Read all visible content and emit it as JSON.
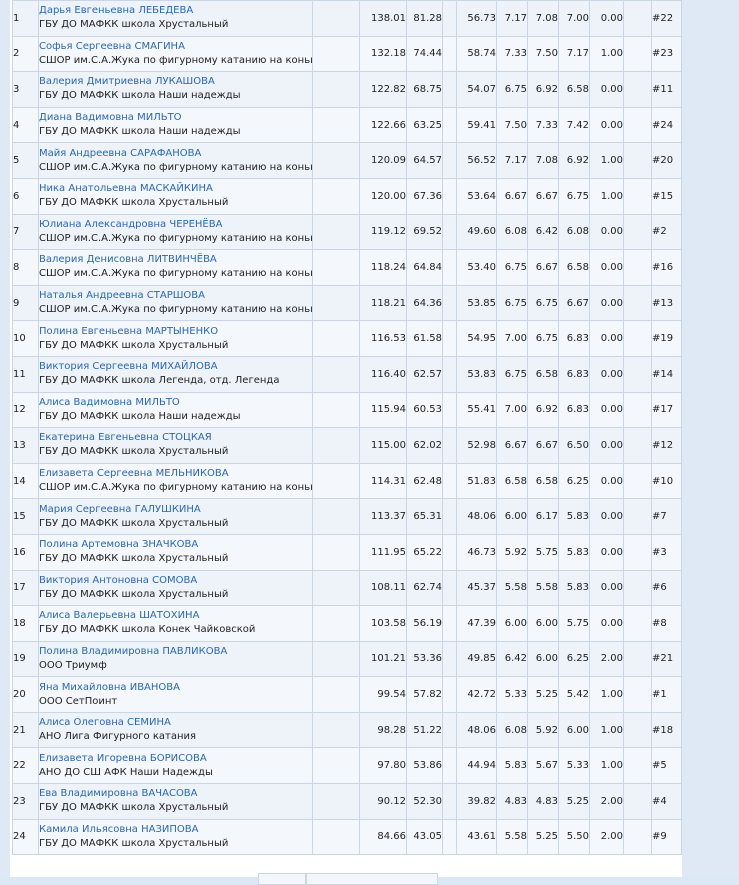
{
  "rows": [
    {
      "place": "1",
      "name": "Дарья Евгеньевна ЛЕБЕДЕВА",
      "club": "ГБУ ДО МАФКК школа Хрустальный",
      "tss": "138.01",
      "tes": "81.28",
      "pcs": "56.73",
      "c1": "7.17",
      "c2": "7.08",
      "c3": "7.00",
      "ded": "0.00",
      "start": "#22"
    },
    {
      "place": "2",
      "name": "Софья Сергеевна СМАГИНА",
      "club": "СШОР им.С.А.Жука по фигурному катанию на коньках",
      "tss": "132.18",
      "tes": "74.44",
      "pcs": "58.74",
      "c1": "7.33",
      "c2": "7.50",
      "c3": "7.17",
      "ded": "1.00",
      "start": "#23"
    },
    {
      "place": "3",
      "name": "Валерия Дмитриевна ЛУКАШОВА",
      "club": "ГБУ ДО МАФКК школа Наши надежды",
      "tss": "122.82",
      "tes": "68.75",
      "pcs": "54.07",
      "c1": "6.75",
      "c2": "6.92",
      "c3": "6.58",
      "ded": "0.00",
      "start": "#11"
    },
    {
      "place": "4",
      "name": "Диана Вадимовна МИЛЬТО",
      "club": "ГБУ ДО МАФКК школа Наши надежды",
      "tss": "122.66",
      "tes": "63.25",
      "pcs": "59.41",
      "c1": "7.50",
      "c2": "7.33",
      "c3": "7.42",
      "ded": "0.00",
      "start": "#24"
    },
    {
      "place": "5",
      "name": "Майя Андреевна САРАФАНОВА",
      "club": "СШОР им.С.А.Жука по фигурному катанию на коньках",
      "tss": "120.09",
      "tes": "64.57",
      "pcs": "56.52",
      "c1": "7.17",
      "c2": "7.08",
      "c3": "6.92",
      "ded": "1.00",
      "start": "#20"
    },
    {
      "place": "6",
      "name": "Ника Анатольевна МАСКАЙКИНА",
      "club": "ГБУ ДО МАФКК школа Хрустальный",
      "tss": "120.00",
      "tes": "67.36",
      "pcs": "53.64",
      "c1": "6.67",
      "c2": "6.67",
      "c3": "6.75",
      "ded": "1.00",
      "start": "#15"
    },
    {
      "place": "7",
      "name": "Юлиана Александровна ЧЕРЕНЁВА",
      "club": "СШОР им.С.А.Жука по фигурному катанию на коньках",
      "tss": "119.12",
      "tes": "69.52",
      "pcs": "49.60",
      "c1": "6.08",
      "c2": "6.42",
      "c3": "6.08",
      "ded": "0.00",
      "start": "#2"
    },
    {
      "place": "8",
      "name": "Валерия Денисовна ЛИТВИНЧЁВА",
      "club": "СШОР им.С.А.Жука по фигурному катанию на коньках",
      "tss": "118.24",
      "tes": "64.84",
      "pcs": "53.40",
      "c1": "6.75",
      "c2": "6.67",
      "c3": "6.58",
      "ded": "0.00",
      "start": "#16"
    },
    {
      "place": "9",
      "name": "Наталья Андреевна СТАРШОВА",
      "club": "СШОР им.С.А.Жука по фигурному катанию на коньках",
      "tss": "118.21",
      "tes": "64.36",
      "pcs": "53.85",
      "c1": "6.75",
      "c2": "6.75",
      "c3": "6.67",
      "ded": "0.00",
      "start": "#13"
    },
    {
      "place": "10",
      "name": "Полина Евгеньевна МАРТЫНЕНКО",
      "club": "ГБУ ДО МАФКК школа Хрустальный",
      "tss": "116.53",
      "tes": "61.58",
      "pcs": "54.95",
      "c1": "7.00",
      "c2": "6.75",
      "c3": "6.83",
      "ded": "0.00",
      "start": "#19"
    },
    {
      "place": "11",
      "name": "Виктория Сергеевна МИХАЙЛОВА",
      "club": "ГБУ ДО МАФКК школа Легенда, отд. Легенда",
      "tss": "116.40",
      "tes": "62.57",
      "pcs": "53.83",
      "c1": "6.75",
      "c2": "6.58",
      "c3": "6.83",
      "ded": "0.00",
      "start": "#14"
    },
    {
      "place": "12",
      "name": "Алиса Вадимовна МИЛЬТО",
      "club": "ГБУ ДО МАФКК школа Наши надежды",
      "tss": "115.94",
      "tes": "60.53",
      "pcs": "55.41",
      "c1": "7.00",
      "c2": "6.92",
      "c3": "6.83",
      "ded": "0.00",
      "start": "#17"
    },
    {
      "place": "13",
      "name": "Екатерина Евгеньевна СТОЦКАЯ",
      "club": "ГБУ ДО МАФКК школа Хрустальный",
      "tss": "115.00",
      "tes": "62.02",
      "pcs": "52.98",
      "c1": "6.67",
      "c2": "6.67",
      "c3": "6.50",
      "ded": "0.00",
      "start": "#12"
    },
    {
      "place": "14",
      "name": "Елизавета Сергеевна МЕЛЬНИКОВА",
      "club": "СШОР им.С.А.Жука по фигурному катанию на коньках",
      "tss": "114.31",
      "tes": "62.48",
      "pcs": "51.83",
      "c1": "6.58",
      "c2": "6.58",
      "c3": "6.25",
      "ded": "0.00",
      "start": "#10"
    },
    {
      "place": "15",
      "name": "Мария Сергеевна ГАЛУШКИНА",
      "club": "ГБУ ДО МАФКК школа Хрустальный",
      "tss": "113.37",
      "tes": "65.31",
      "pcs": "48.06",
      "c1": "6.00",
      "c2": "6.17",
      "c3": "5.83",
      "ded": "0.00",
      "start": "#7"
    },
    {
      "place": "16",
      "name": "Полина Артемовна ЗНАЧКОВА",
      "club": "ГБУ ДО МАФКК школа Хрустальный",
      "tss": "111.95",
      "tes": "65.22",
      "pcs": "46.73",
      "c1": "5.92",
      "c2": "5.75",
      "c3": "5.83",
      "ded": "0.00",
      "start": "#3"
    },
    {
      "place": "17",
      "name": "Виктория Антоновна СОМОВА",
      "club": "ГБУ ДО МАФКК школа Хрустальный",
      "tss": "108.11",
      "tes": "62.74",
      "pcs": "45.37",
      "c1": "5.58",
      "c2": "5.58",
      "c3": "5.83",
      "ded": "0.00",
      "start": "#6"
    },
    {
      "place": "18",
      "name": "Алиса Валерьевна ШАТОХИНА",
      "club": "ГБУ ДО МАФКК школа Конек Чайковской",
      "tss": "103.58",
      "tes": "56.19",
      "pcs": "47.39",
      "c1": "6.00",
      "c2": "6.00",
      "c3": "5.75",
      "ded": "0.00",
      "start": "#8"
    },
    {
      "place": "19",
      "name": "Полина Владимировна ПАВЛИКОВА",
      "club": "ООО Триумф",
      "tss": "101.21",
      "tes": "53.36",
      "pcs": "49.85",
      "c1": "6.42",
      "c2": "6.00",
      "c3": "6.25",
      "ded": "2.00",
      "start": "#21"
    },
    {
      "place": "20",
      "name": "Яна Михайловна ИВАНОВА",
      "club": "ООО СетПоинт",
      "tss": "99.54",
      "tes": "57.82",
      "pcs": "42.72",
      "c1": "5.33",
      "c2": "5.25",
      "c3": "5.42",
      "ded": "1.00",
      "start": "#1"
    },
    {
      "place": "21",
      "name": "Алиса Олеговна СЕМИНА",
      "club": "АНО Лига Фигурного катания",
      "tss": "98.28",
      "tes": "51.22",
      "pcs": "48.06",
      "c1": "6.08",
      "c2": "5.92",
      "c3": "6.00",
      "ded": "1.00",
      "start": "#18"
    },
    {
      "place": "22",
      "name": "Елизавета Игоревна БОРИСОВА",
      "club": "АНО ДО СШ АФК Наши Надежды",
      "tss": "97.80",
      "tes": "53.86",
      "pcs": "44.94",
      "c1": "5.83",
      "c2": "5.67",
      "c3": "5.33",
      "ded": "1.00",
      "start": "#5"
    },
    {
      "place": "23",
      "name": "Ева Владимировна ВАЧАСОВА",
      "club": "ГБУ ДО МАФКК школа Хрустальный",
      "tss": "90.12",
      "tes": "52.30",
      "pcs": "39.82",
      "c1": "4.83",
      "c2": "4.83",
      "c3": "5.25",
      "ded": "2.00",
      "start": "#4"
    },
    {
      "place": "24",
      "name": "Камила Ильясовна НАЗИПОВА",
      "club": "ГБУ ДО МАФКК школа Хрустальный",
      "tss": "84.66",
      "tes": "43.05",
      "pcs": "43.61",
      "c1": "5.58",
      "c2": "5.25",
      "c3": "5.50",
      "ded": "2.00",
      "start": "#9"
    }
  ]
}
